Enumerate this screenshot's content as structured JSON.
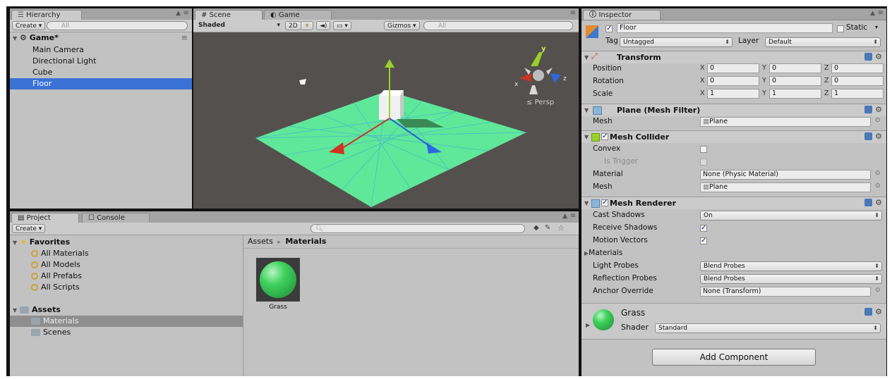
{
  "hierarchy": {
    "tab_label": "Hierarchy",
    "create_label": "Create",
    "search_placeholder": "All",
    "scene_name": "Game*",
    "items": [
      "Main Camera",
      "Directional Light",
      "Cube",
      "Floor"
    ],
    "selected": "Floor"
  },
  "scene_view": {
    "tab_scene": "Scene",
    "tab_game": "Game",
    "shading_mode": "Shaded",
    "mode_2d": "2D",
    "gizmos_label": "Gizmos",
    "search_placeholder": "All",
    "persp_label": "Persp",
    "gizmo_axes": {
      "x": "x",
      "y": "y",
      "z": "z"
    },
    "floor_color": "#5fe89a",
    "bg_color": "#54504d"
  },
  "project": {
    "tab_project": "Project",
    "tab_console": "Console",
    "create_label": "Create",
    "favorites_label": "Favorites",
    "favorites": [
      "All Materials",
      "All Models",
      "All Prefabs",
      "All Scripts"
    ],
    "assets_label": "Assets",
    "asset_folders": [
      "Materials",
      "Scenes"
    ],
    "selected_folder": "Materials",
    "breadcrumb_root": "Assets",
    "breadcrumb_sep": "▸",
    "breadcrumb_current": "Materials",
    "asset_items": [
      {
        "name": "Grass",
        "color": "#3fd25e"
      }
    ]
  },
  "inspector": {
    "tab_label": "Inspector",
    "object_name": "Floor",
    "static_label": "Static",
    "tag_label": "Tag",
    "tag_value": "Untagged",
    "layer_label": "Layer",
    "layer_value": "Default",
    "transform": {
      "title": "Transform",
      "position_label": "Position",
      "rotation_label": "Rotation",
      "scale_label": "Scale",
      "position": [
        "0",
        "0",
        "0"
      ],
      "rotation": [
        "0",
        "0",
        "0"
      ],
      "scale": [
        "1",
        "1",
        "1"
      ]
    },
    "mesh_filter": {
      "title": "Plane (Mesh Filter)",
      "mesh_label": "Mesh",
      "mesh_value": "Plane"
    },
    "mesh_collider": {
      "title": "Mesh Collider",
      "convex_label": "Convex",
      "is_trigger_label": "Is Trigger",
      "material_label": "Material",
      "material_value": "None (Physic Material)",
      "mesh_label": "Mesh",
      "mesh_value": "Plane"
    },
    "mesh_renderer": {
      "title": "Mesh Renderer",
      "cast_shadows_label": "Cast Shadows",
      "cast_shadows_value": "On",
      "receive_shadows_label": "Receive Shadows",
      "motion_vectors_label": "Motion Vectors",
      "materials_label": "Materials",
      "light_probes_label": "Light Probes",
      "light_probes_value": "Blend Probes",
      "reflection_probes_label": "Reflection Probes",
      "reflection_probes_value": "Blend Probes",
      "anchor_override_label": "Anchor Override",
      "anchor_override_value": "None (Transform)"
    },
    "material": {
      "name": "Grass",
      "shader_label": "Shader",
      "shader_value": "Standard",
      "color": "#3fd25e"
    },
    "add_component_label": "Add Component"
  }
}
